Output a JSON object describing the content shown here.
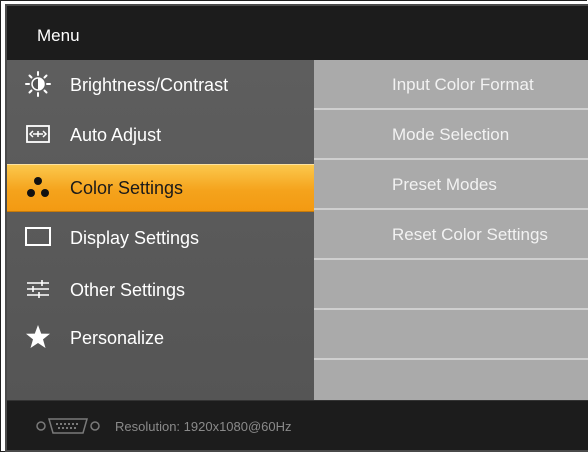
{
  "header": {
    "title": "Menu"
  },
  "menu": {
    "items": [
      {
        "label": "Brightness/Contrast",
        "icon": "brightness-icon"
      },
      {
        "label": "Auto Adjust",
        "icon": "auto-adjust-icon"
      },
      {
        "label": "Color Settings",
        "icon": "color-settings-icon",
        "selected": true
      },
      {
        "label": "Display Settings",
        "icon": "display-icon"
      },
      {
        "label": "Other Settings",
        "icon": "sliders-icon"
      },
      {
        "label": "Personalize",
        "icon": "star-icon"
      }
    ]
  },
  "submenu": {
    "items": [
      {
        "label": "Input Color Format"
      },
      {
        "label": "Mode Selection"
      },
      {
        "label": "Preset Modes"
      },
      {
        "label": "Reset Color Settings"
      },
      {
        "label": ""
      },
      {
        "label": ""
      }
    ]
  },
  "footer": {
    "connector_icon": "vga-connector-icon",
    "resolution_text": "Resolution:  1920x1080@60Hz"
  },
  "colors": {
    "selected_accent": "#f5a31c",
    "panel_bg": "#5b5b5b",
    "submenu_bg": "#aaaaaa"
  }
}
